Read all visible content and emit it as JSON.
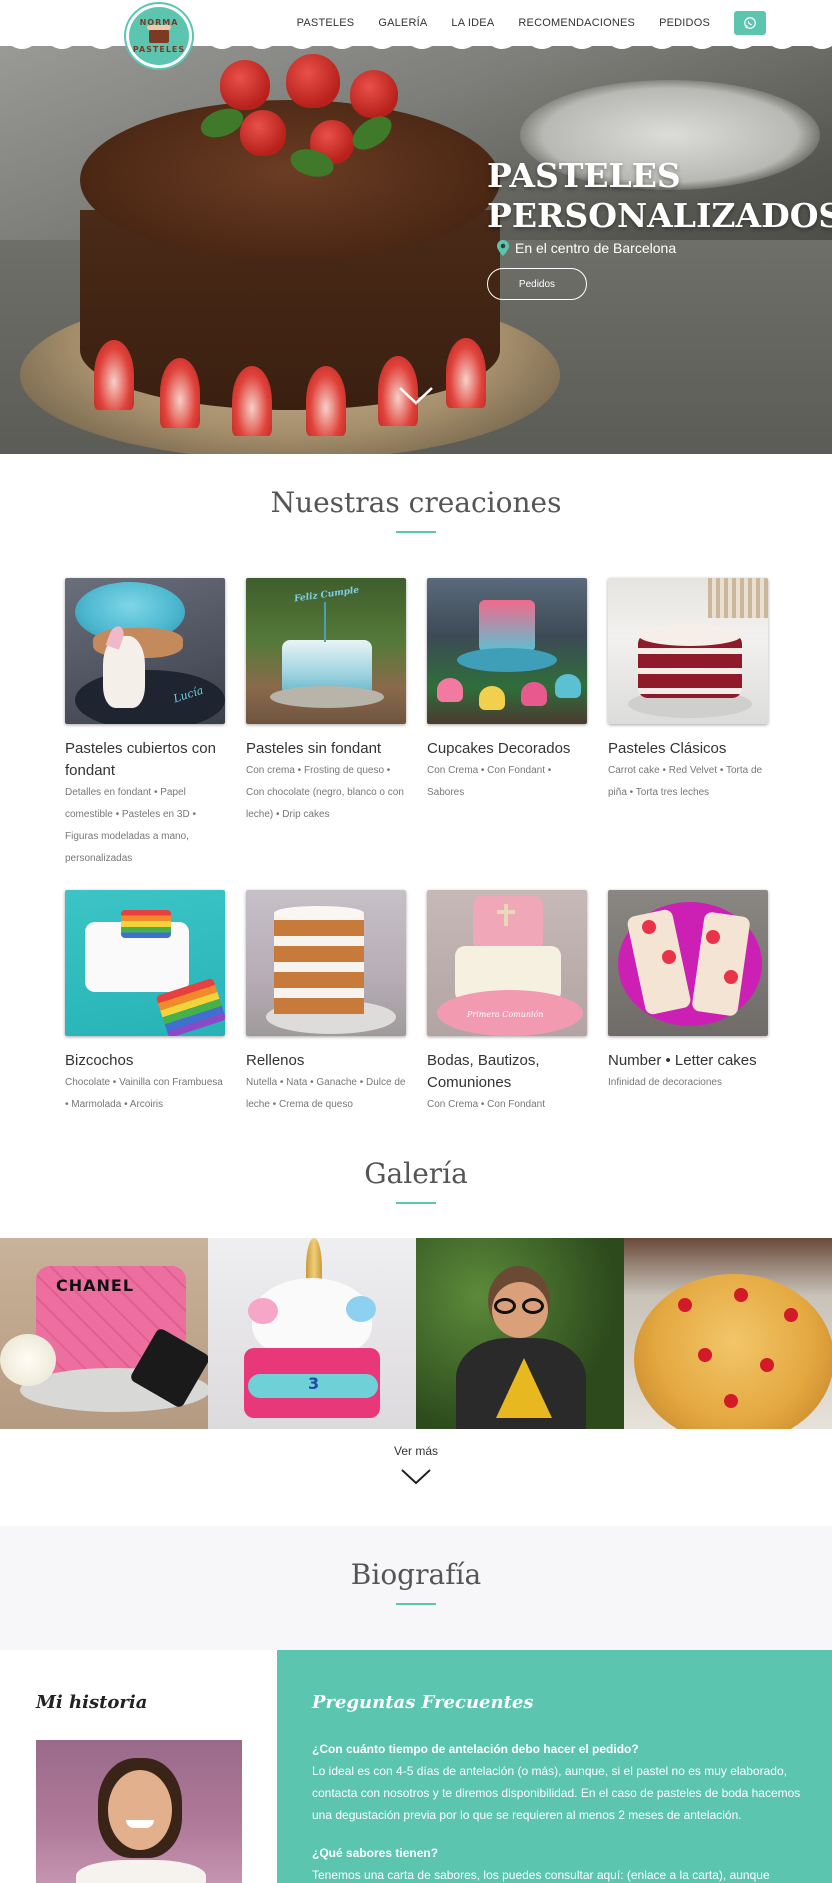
{
  "logo": {
    "top_text": "NORMA",
    "bottom_text": "PASTELES"
  },
  "nav": {
    "items": [
      "PASTELES",
      "GALERÍA",
      "LA IDEA",
      "RECOMENDACIONES",
      "PEDIDOS"
    ]
  },
  "hero": {
    "title_line1": "PASTELES",
    "title_line2": "PERSONALIZADOS",
    "location": "En el centro de Barcelona",
    "button": "Pedidos"
  },
  "creaciones": {
    "title": "Nuestras creaciones",
    "cards": [
      {
        "title": "Pasteles cubiertos con fondant",
        "desc": "Detalles en fondant • Papel comestible • Pasteles en 3D • Figuras modeladas a mano, personalizadas",
        "photo_text": "Lucía"
      },
      {
        "title": "Pasteles sin fondant",
        "desc": "Con crema • Frosting de queso • Con chocolate (negro, blanco o con leche) • Drip cakes",
        "photo_text": "Feliz Cumple"
      },
      {
        "title": "Cupcakes Decorados",
        "desc": "Con Crema • Con Fondant • Sabores"
      },
      {
        "title": "Pasteles Clásicos",
        "desc": "Carrot cake • Red Velvet • Torta de piña • Torta tres leches"
      },
      {
        "title": "Bizcochos",
        "desc": "Chocolate • Vainilla con Frambuesa • Marmolada • Arcoiris"
      },
      {
        "title": "Rellenos",
        "desc": "Nutella • Nata • Ganache • Dulce de leche • Crema de queso"
      },
      {
        "title": "Bodas, Bautizos, Comuniones",
        "desc": "Con Crema • Con Fondant",
        "photo_text": "Primera Comunión"
      },
      {
        "title": "Number • Letter cakes",
        "desc": "Infinidad de decoraciones"
      }
    ]
  },
  "galeria": {
    "title": "Galería",
    "photo_texts": [
      "CHANEL",
      "3"
    ],
    "ver_mas": "Ver más"
  },
  "biografia": {
    "title": "Biografía"
  },
  "historia": {
    "title": "Mi historia"
  },
  "faq": {
    "title": "Preguntas Frecuentes",
    "items": [
      {
        "q": "¿Con cuánto tiempo de antelación debo hacer el pedido?",
        "a": "Lo ideal es con 4-5 días de antelación (o más), aunque, si el pastel no es muy elaborado, contacta con nosotros y te diremos disponibilidad. En el caso de pasteles de boda hacemos una degustación previa por lo que se requieren al menos 2 meses de antelación."
      },
      {
        "q": "¿Qué sabores tienen?",
        "a": "Tenemos una carta de sabores, los puedes consultar aquí: (enlace a la carta), aunque"
      }
    ]
  },
  "colors": {
    "accent": "#5cc5b0",
    "text": "#333333",
    "muted": "#777777"
  }
}
